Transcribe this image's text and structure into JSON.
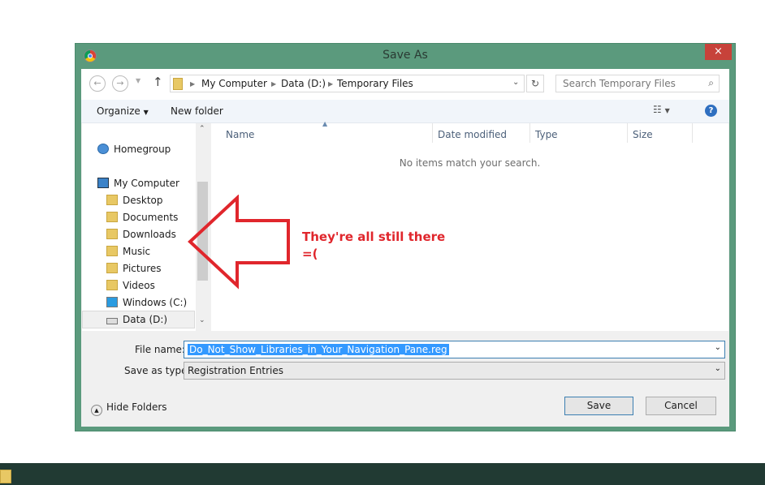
{
  "window": {
    "title": "Save As",
    "close_icon": "×"
  },
  "address": {
    "crumbs": [
      "My Computer",
      "Data (D:)",
      "Temporary Files"
    ],
    "search_placeholder": "Search Temporary Files"
  },
  "toolbar": {
    "organize": "Organize",
    "new_folder": "New folder"
  },
  "nav": {
    "items": [
      {
        "label": "Homegroup"
      },
      {
        "label": "My Computer"
      },
      {
        "label": "Desktop"
      },
      {
        "label": "Documents"
      },
      {
        "label": "Downloads"
      },
      {
        "label": "Music"
      },
      {
        "label": "Pictures"
      },
      {
        "label": "Videos"
      },
      {
        "label": "Windows (C:)"
      },
      {
        "label": "Data (D:)"
      }
    ]
  },
  "list": {
    "columns": [
      "Name",
      "Date modified",
      "Type",
      "Size"
    ],
    "empty": "No items match your search."
  },
  "form": {
    "file_name_label": "File name:",
    "file_name": "Do_Not_Show_Libraries_in_Your_Navigation_Pane.reg",
    "type_label": "Save as type:",
    "type": "Registration Entries"
  },
  "footer": {
    "hide_folders": "Hide Folders",
    "save": "Save",
    "cancel": "Cancel"
  },
  "annotation": {
    "line1": "They're all still there",
    "line2": "=(",
    "color": "#e0262c"
  }
}
